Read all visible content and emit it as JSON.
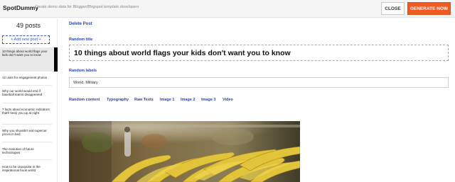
{
  "header": {
    "brand": "SpotDummy",
    "tagline": "Create demo data for Blogger/Blogspot template developers",
    "close_label": "CLOSE",
    "generate_label": "GENERATE NOW"
  },
  "sidebar": {
    "post_count": "49 posts",
    "add_label": "+ Add new post +",
    "posts": [
      "10 things about world flags your kids don't want you to know",
      "12 uses for engagement photos",
      "Why our world would end if baseball teams disappeared",
      "7 facts about economic indicators that'll keep you up at night",
      "Why you shouldn't eat supercar prices in bed",
      "The evolution of future technologies",
      "How to be unpopular in the inspirational book world"
    ]
  },
  "main": {
    "delete_label": "Delete Post",
    "random_title_label": "Random title",
    "title_value": "10 things about world flags your kids don't want you to know",
    "random_labels_label": "Random labels",
    "labels_value": "World, Military",
    "tabs": [
      "Random content",
      "Typography",
      "Raw Texts",
      "Image 1",
      "Image 2",
      "Image 3",
      "Video"
    ]
  },
  "colors": {
    "accent": "#f05a22",
    "link": "#2244bb"
  },
  "icons": [
    "plus-icon"
  ]
}
